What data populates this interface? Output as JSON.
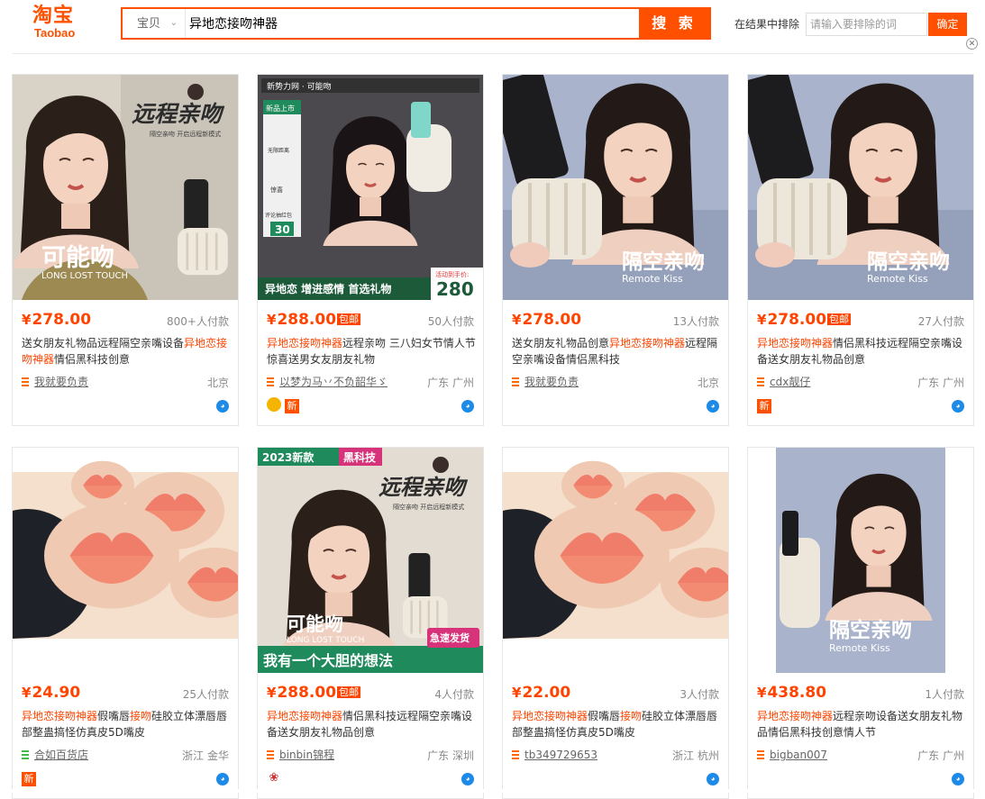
{
  "header": {
    "logo_cn": "淘宝",
    "logo_en": "Taobao",
    "search_category": "宝贝",
    "search_query": "异地恋接吻神器",
    "search_button": "搜 索",
    "exclude_label": "在结果中排除",
    "exclude_placeholder": "请输入要排除的词",
    "exclude_button": "确定"
  },
  "colors": {
    "accent": "#ff5000",
    "price": "#ff4400",
    "wangwang": "#1d8ae8"
  },
  "products": [
    {
      "price": "278.00",
      "baoyou": "",
      "deals": "800+人付款",
      "title_segments": [
        {
          "t": "送女朋友礼物品远程隔空亲嘴设备",
          "h": false
        },
        {
          "t": "异地恋接吻神器",
          "h": true
        },
        {
          "t": "情侣黑科技创意",
          "h": false
        }
      ],
      "shop": "我就要负责",
      "location": "北京",
      "badges": [],
      "image_text": {
        "top": "远程亲吻",
        "sub": "隔空亲吻 开启远程新模式",
        "bottom": "可能吻",
        "bottom_en": "LONG LOST TOUCH"
      }
    },
    {
      "price": "288.00",
      "baoyou": "包邮",
      "deals": "50人付款",
      "title_segments": [
        {
          "t": "异地恋接吻神器",
          "h": true
        },
        {
          "t": "远程亲吻 三八妇女节情人节惊喜送男女友朋友礼物",
          "h": false
        }
      ],
      "shop": "以梦为马丷不负韶华ゞ",
      "location": "广东 广州",
      "badges": [
        "gold",
        "新"
      ],
      "image_text": {
        "brand": "新势力网 · 可能吻",
        "tag1": "新品上市",
        "tag2": "无限距离",
        "tag3": "惊喜",
        "review": "评论抽红包",
        "num": "30",
        "banner": "异地恋 增进感情 首选礼物",
        "promo": "活动到手价:",
        "promo_price": "280"
      }
    },
    {
      "price": "278.00",
      "baoyou": "",
      "deals": "13人付款",
      "title_segments": [
        {
          "t": "送女朋友礼物品创意",
          "h": false
        },
        {
          "t": "异地恋接吻神器",
          "h": true
        },
        {
          "t": "远程隔空亲嘴设备情侣黑科技",
          "h": false
        }
      ],
      "shop": "我就要负责",
      "location": "北京",
      "badges": [],
      "image_text": {
        "cn": "隔空亲吻",
        "en": "Remote Kiss"
      }
    },
    {
      "price": "278.00",
      "baoyou": "包邮",
      "deals": "27人付款",
      "title_segments": [
        {
          "t": "异地恋接吻神器",
          "h": true
        },
        {
          "t": "情侣黑科技远程隔空亲嘴设备送女朋友礼物品创意",
          "h": false
        }
      ],
      "shop": "cdx靓仔",
      "location": "广东 广州",
      "badges": [
        "新"
      ],
      "image_text": {
        "cn": "隔空亲吻",
        "en": "Remote Kiss"
      }
    },
    {
      "price": "24.90",
      "baoyou": "",
      "deals": "25人付款",
      "title_segments": [
        {
          "t": "异地恋接吻神器",
          "h": true
        },
        {
          "t": "假嘴唇",
          "h": false
        },
        {
          "t": "接吻",
          "h": true
        },
        {
          "t": "硅胶立体漂唇唇部整蛊搞怪仿真皮5D嘴皮",
          "h": false
        }
      ],
      "shop": "合如百货店",
      "location": "浙江 金华",
      "badges": [
        "新"
      ],
      "shop_green": true,
      "image_text": {}
    },
    {
      "price": "288.00",
      "baoyou": "包邮",
      "deals": "4人付款",
      "title_segments": [
        {
          "t": "异地恋接吻神器",
          "h": true
        },
        {
          "t": "情侣黑科技远程隔空亲嘴设备送女朋友礼物品创意",
          "h": false
        }
      ],
      "shop": "binbin锦程",
      "location": "广东 深圳",
      "badges": [
        "flower"
      ],
      "image_text": {
        "tag_a": "2023新款",
        "tag_b": "黑科技",
        "top": "远程亲吻",
        "sub": "隔空亲吻 开启远程新模式",
        "bottom": "可能吻",
        "bottom_en": "LONG LOST TOUCH",
        "banner": "我有一个大胆的想法",
        "ship": "急速发货"
      }
    },
    {
      "price": "22.00",
      "baoyou": "",
      "deals": "3人付款",
      "title_segments": [
        {
          "t": "异地恋接吻神器",
          "h": true
        },
        {
          "t": "假嘴唇",
          "h": false
        },
        {
          "t": "接吻",
          "h": true
        },
        {
          "t": "硅胶立体漂唇唇部整蛊搞怪仿真皮5D嘴皮",
          "h": false
        }
      ],
      "shop": "tb349729653",
      "location": "浙江 杭州",
      "badges": [],
      "image_text": {}
    },
    {
      "price": "438.80",
      "baoyou": "",
      "deals": "1人付款",
      "title_segments": [
        {
          "t": "异地恋接吻神器",
          "h": true
        },
        {
          "t": "远程亲吻设备送女朋友礼物品情侣黑科技创意情人节",
          "h": false
        }
      ],
      "shop": "bigban007",
      "location": "广东 广州",
      "badges": [],
      "image_text": {
        "cn": "隔空亲吻",
        "en": "Remote Kiss"
      }
    }
  ]
}
